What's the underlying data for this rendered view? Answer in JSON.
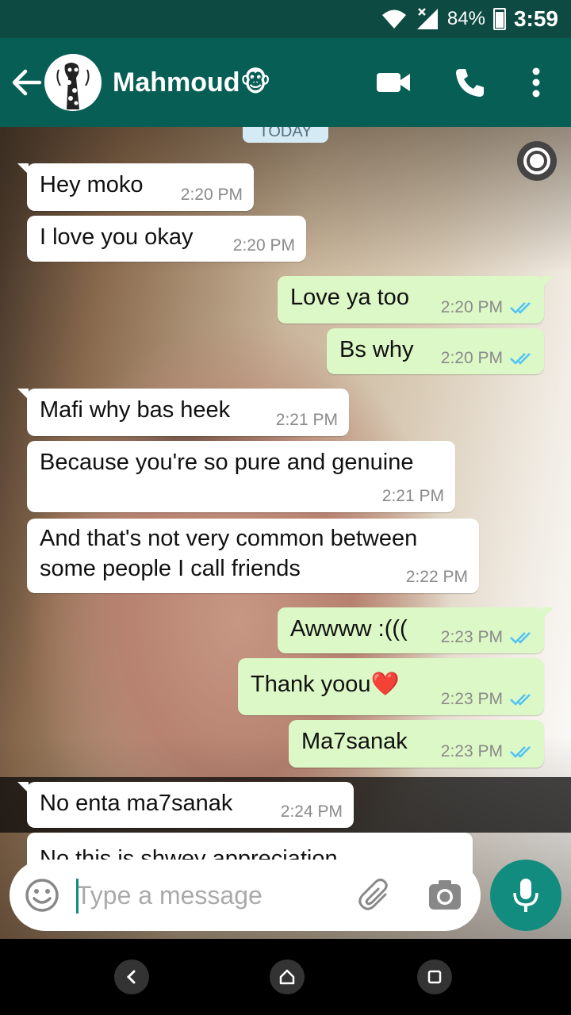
{
  "status_bar": {
    "battery": "84%",
    "time": "3:59"
  },
  "header": {
    "contact_name": "Mahmoud",
    "contact_emoji": "🐵"
  },
  "date_chip": "TODAY",
  "messages": [
    {
      "dir": "in",
      "text": "Hey moko",
      "time": "2:20 PM"
    },
    {
      "dir": "in",
      "text": "I love you okay",
      "time": "2:20 PM"
    },
    {
      "dir": "out",
      "text": "Love ya too",
      "time": "2:20 PM"
    },
    {
      "dir": "out",
      "text": "Bs why",
      "time": "2:20 PM"
    },
    {
      "dir": "in",
      "text": "Mafi why bas heek",
      "time": "2:21 PM"
    },
    {
      "dir": "in",
      "text": "Because you're so pure and genuine",
      "time": "2:21 PM"
    },
    {
      "dir": "in",
      "line1": "And that's not very common between",
      "line2": "some people I call friends",
      "time": "2:22 PM"
    },
    {
      "dir": "out",
      "text": "Awwww :(((",
      "time": "2:23 PM"
    },
    {
      "dir": "out",
      "text": "Thank yoou",
      "emoji": "❤️",
      "time": "2:23 PM"
    },
    {
      "dir": "out",
      "text": "Ma7sanak",
      "time": "2:23 PM"
    },
    {
      "dir": "in",
      "text": "No enta ma7sanak",
      "time": "2:24 PM"
    },
    {
      "dir": "in",
      "text": "No this is shwey appreciation",
      "time": ""
    }
  ],
  "composer": {
    "placeholder": "Type a message"
  },
  "colors": {
    "header": "#075e54",
    "status_bar": "#0d4a42",
    "accent": "#128c7e",
    "outgoing_bubble": "#dcf8c6",
    "read_ticks": "#4fc3f7"
  },
  "icons": {
    "back": "arrow-left-icon",
    "video": "video-camera-icon",
    "call": "phone-icon",
    "menu": "more-vert-icon",
    "emoji": "smiley-icon",
    "attach": "paperclip-icon",
    "camera": "camera-icon",
    "mic": "microphone-icon"
  }
}
